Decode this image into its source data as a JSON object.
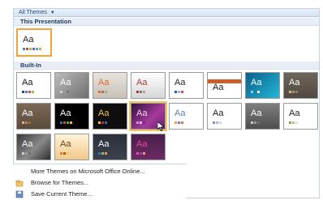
{
  "header": {
    "title": "All Themes",
    "caret": "▼"
  },
  "sections": {
    "this_presentation": "This Presentation",
    "built_in": "Built-In"
  },
  "thumb_text": "Aa",
  "menu": {
    "items": [
      {
        "label": "More Themes on Microsoft Office Online...",
        "icon": "blank"
      },
      {
        "label": "Browse for Themes...",
        "icon": "folder-icon"
      },
      {
        "label": "Save Current Theme...",
        "icon": "save-icon"
      }
    ]
  }
}
